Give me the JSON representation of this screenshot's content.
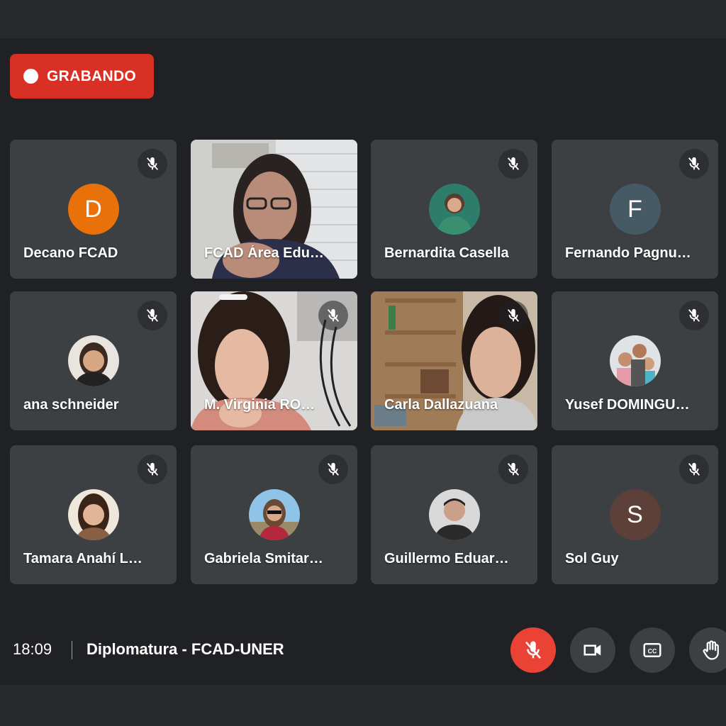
{
  "recording": {
    "label": "GRABANDO",
    "color": "#d93025"
  },
  "participants": [
    {
      "name": "Decano FCAD",
      "initial": "D",
      "avatar_color": "#e8710a",
      "muted": true
    },
    {
      "name": "FCAD Área Edu…",
      "video": true,
      "muted": false
    },
    {
      "name": "Bernardita Casella",
      "avatar": "photo",
      "muted": true
    },
    {
      "name": "Fernando Pagnu…",
      "initial": "F",
      "avatar_color": "#455a64",
      "muted": true
    },
    {
      "name": "ana schneider",
      "avatar": "photo",
      "muted": true
    },
    {
      "name": "M. Virginia RO…",
      "video": true,
      "muted": true
    },
    {
      "name": "Carla Dallazuana",
      "video": true,
      "muted": true
    },
    {
      "name": "Yusef DOMINGU…",
      "avatar": "photo",
      "muted": true
    },
    {
      "name": "Tamara Anahí L…",
      "avatar": "photo",
      "muted": true
    },
    {
      "name": "Gabriela Smitar…",
      "avatar": "photo",
      "muted": true
    },
    {
      "name": "Guillermo Eduar…",
      "avatar": "photo",
      "muted": true
    },
    {
      "name": "Sol Guy",
      "initial": "S",
      "avatar_color": "#5d4037",
      "muted": true
    }
  ],
  "footer": {
    "time": "18:09",
    "meeting_title": "Diplomatura - FCAD-UNER"
  },
  "controls": {
    "mic": {
      "icon": "mic-off-icon",
      "state": "off",
      "color": "#ea4335"
    },
    "camera": {
      "icon": "videocam-icon"
    },
    "captions": {
      "icon": "closed-captions-icon"
    },
    "hand": {
      "icon": "raise-hand-icon"
    }
  }
}
